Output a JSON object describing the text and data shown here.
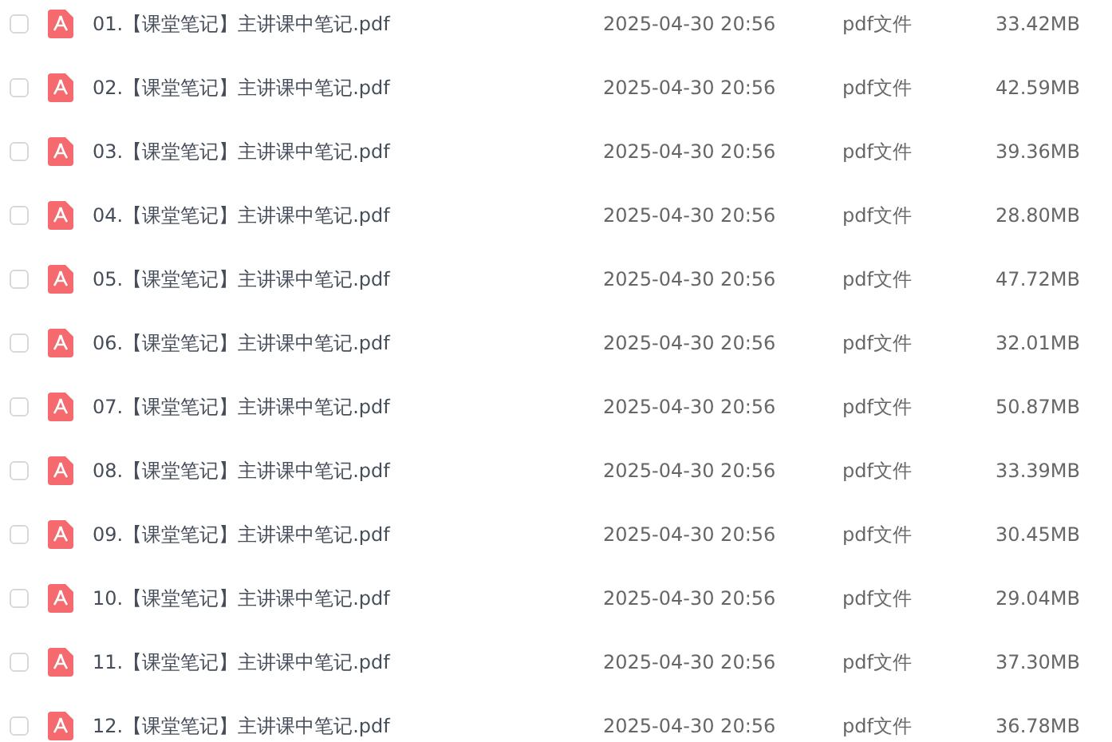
{
  "files": [
    {
      "name": "01.【课堂笔记】主讲课中笔记.pdf",
      "modified": "2025-04-30 20:56",
      "type": "pdf文件",
      "size": "33.42MB",
      "checked": false
    },
    {
      "name": "02.【课堂笔记】主讲课中笔记.pdf",
      "modified": "2025-04-30 20:56",
      "type": "pdf文件",
      "size": "42.59MB",
      "checked": false
    },
    {
      "name": "03.【课堂笔记】主讲课中笔记.pdf",
      "modified": "2025-04-30 20:56",
      "type": "pdf文件",
      "size": "39.36MB",
      "checked": false
    },
    {
      "name": "04.【课堂笔记】主讲课中笔记.pdf",
      "modified": "2025-04-30 20:56",
      "type": "pdf文件",
      "size": "28.80MB",
      "checked": false
    },
    {
      "name": "05.【课堂笔记】主讲课中笔记.pdf",
      "modified": "2025-04-30 20:56",
      "type": "pdf文件",
      "size": "47.72MB",
      "checked": false
    },
    {
      "name": "06.【课堂笔记】主讲课中笔记.pdf",
      "modified": "2025-04-30 20:56",
      "type": "pdf文件",
      "size": "32.01MB",
      "checked": false
    },
    {
      "name": "07.【课堂笔记】主讲课中笔记.pdf",
      "modified": "2025-04-30 20:56",
      "type": "pdf文件",
      "size": "50.87MB",
      "checked": false
    },
    {
      "name": "08.【课堂笔记】主讲课中笔记.pdf",
      "modified": "2025-04-30 20:56",
      "type": "pdf文件",
      "size": "33.39MB",
      "checked": false
    },
    {
      "name": "09.【课堂笔记】主讲课中笔记.pdf",
      "modified": "2025-04-30 20:56",
      "type": "pdf文件",
      "size": "30.45MB",
      "checked": false
    },
    {
      "name": "10.【课堂笔记】主讲课中笔记.pdf",
      "modified": "2025-04-30 20:56",
      "type": "pdf文件",
      "size": "29.04MB",
      "checked": false
    },
    {
      "name": "11.【课堂笔记】主讲课中笔记.pdf",
      "modified": "2025-04-30 20:56",
      "type": "pdf文件",
      "size": "37.30MB",
      "checked": false
    },
    {
      "name": "12.【课堂笔记】主讲课中笔记.pdf",
      "modified": "2025-04-30 20:56",
      "type": "pdf文件",
      "size": "36.78MB",
      "checked": false
    }
  ]
}
